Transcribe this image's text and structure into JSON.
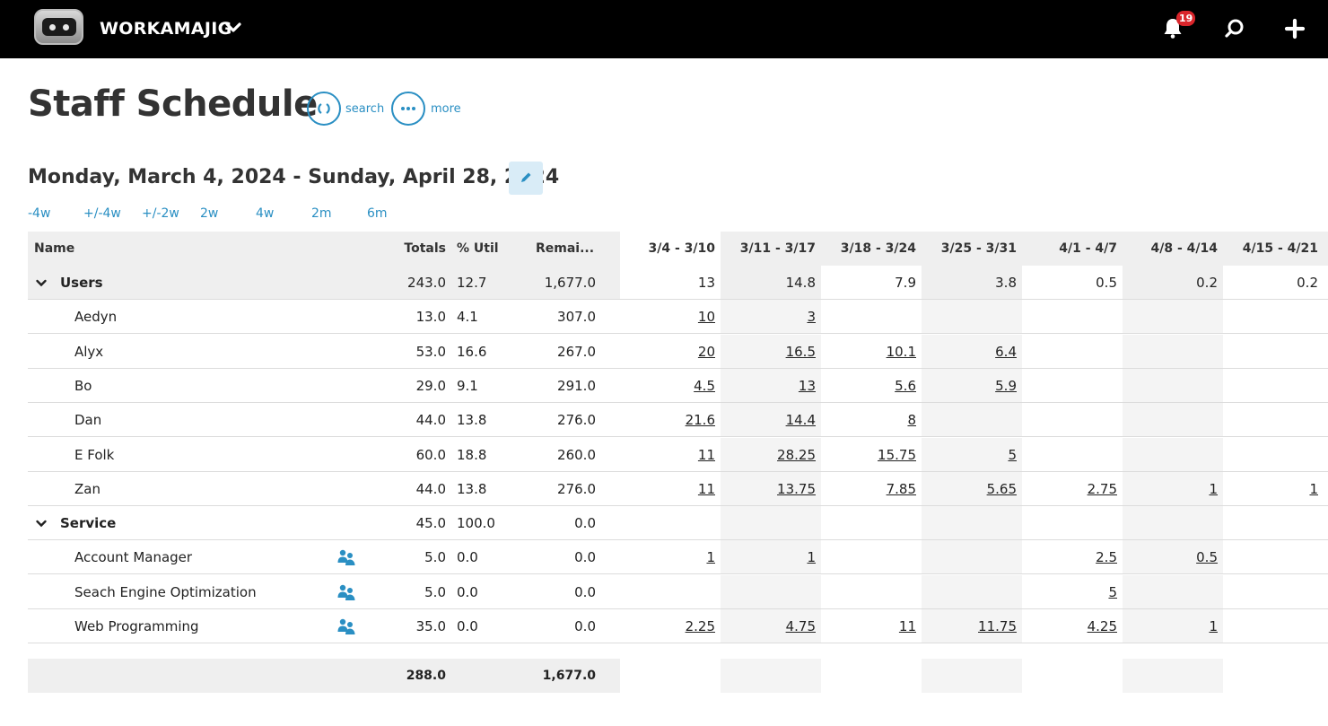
{
  "app": {
    "name": "WORKAMAJIG",
    "notification_count": "19"
  },
  "page": {
    "title": "Staff Schedule",
    "search_label": "search",
    "more_label": "more",
    "date_range": "Monday, March 4, 2024 - Sunday, April 28, 2024"
  },
  "range_buttons": [
    "-4w",
    "+/-4w",
    "+/-2w",
    "2w",
    "4w",
    "2m",
    "6m"
  ],
  "table": {
    "headers": {
      "name": "Name",
      "totals": "Totals",
      "util": "% Util",
      "remaining": "Remai...",
      "weeks": [
        "3/4 - 3/10",
        "3/11 - 3/17",
        "3/18 - 3/24",
        "3/25 - 3/31",
        "4/1 - 4/7",
        "4/8 - 4/14",
        "4/15 - 4/21"
      ]
    },
    "rows": [
      {
        "type": "group",
        "name": "Users",
        "totals": "243.0",
        "util": "12.7",
        "remaining": "1,677.0",
        "weeks": [
          "13",
          "14.8",
          "7.9",
          "3.8",
          "0.5",
          "0.2",
          "0.2"
        ]
      },
      {
        "type": "item",
        "name": "Aedyn",
        "totals": "13.0",
        "util": "4.1",
        "remaining": "307.0",
        "weeks": [
          "10",
          "3",
          "",
          "",
          "",
          "",
          ""
        ]
      },
      {
        "type": "item",
        "name": "Alyx",
        "totals": "53.0",
        "util": "16.6",
        "remaining": "267.0",
        "weeks": [
          "20",
          "16.5",
          "10.1",
          "6.4",
          "",
          "",
          ""
        ]
      },
      {
        "type": "item",
        "name": "Bo",
        "totals": "29.0",
        "util": "9.1",
        "remaining": "291.0",
        "weeks": [
          "4.5",
          "13",
          "5.6",
          "5.9",
          "",
          "",
          ""
        ]
      },
      {
        "type": "item",
        "name": "Dan",
        "totals": "44.0",
        "util": "13.8",
        "remaining": "276.0",
        "weeks": [
          "21.6",
          "14.4",
          "8",
          "",
          "",
          "",
          ""
        ]
      },
      {
        "type": "item",
        "name": "E Folk",
        "totals": "60.0",
        "util": "18.8",
        "remaining": "260.0",
        "weeks": [
          "11",
          "28.25",
          "15.75",
          "5",
          "",
          "",
          ""
        ]
      },
      {
        "type": "item",
        "name": "Zan",
        "totals": "44.0",
        "util": "13.8",
        "remaining": "276.0",
        "weeks": [
          "11",
          "13.75",
          "7.85",
          "5.65",
          "2.75",
          "1",
          "1"
        ]
      },
      {
        "type": "group2",
        "name": "Service",
        "totals": "45.0",
        "util": "100.0",
        "remaining": "0.0",
        "weeks": [
          "",
          "",
          "",
          "",
          "",
          "",
          ""
        ]
      },
      {
        "type": "service",
        "name": "Account Manager",
        "totals": "5.0",
        "util": "0.0",
        "remaining": "0.0",
        "weeks": [
          "1",
          "1",
          "",
          "",
          "2.5",
          "0.5",
          ""
        ]
      },
      {
        "type": "service",
        "name": "Seach Engine Optimization",
        "totals": "5.0",
        "util": "0.0",
        "remaining": "0.0",
        "weeks": [
          "",
          "",
          "",
          "",
          "5",
          "",
          ""
        ]
      },
      {
        "type": "service",
        "name": "Web Programming",
        "totals": "35.0",
        "util": "0.0",
        "remaining": "0.0",
        "weeks": [
          "2.25",
          "4.75",
          "11",
          "11.75",
          "4.25",
          "1",
          ""
        ]
      }
    ],
    "footer": {
      "totals": "288.0",
      "remaining": "1,677.0"
    }
  }
}
